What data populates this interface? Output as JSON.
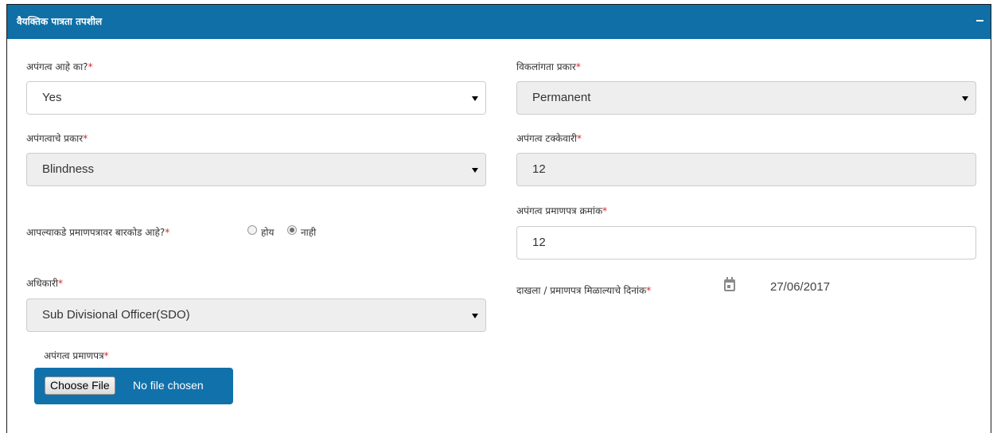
{
  "panel": {
    "title": "वैयक्तिक पात्रता तपशील",
    "collapse_symbol": "−"
  },
  "fields": {
    "disability": {
      "label": "अपंगत्व आहे का?",
      "required_mark": "*",
      "value": "Yes"
    },
    "handicap_type": {
      "label": "विकलांगता प्रकार",
      "required_mark": "*",
      "value": "Permanent"
    },
    "disability_type": {
      "label": "अपंगत्वाचे प्रकार",
      "required_mark": "*",
      "value": "Blindness"
    },
    "disability_percentage": {
      "label": "अपंगत्व टक्केवारी",
      "required_mark": "*",
      "value": "12"
    },
    "barcode_question": {
      "label": "आपल्याकडे प्रमाणपत्रावर बारकोड आहे?",
      "required_mark": "*",
      "options": [
        "होय",
        "नाही"
      ],
      "selected": "नाही"
    },
    "certificate_number": {
      "label": "अपंगत्व प्रमाणपत्र क्रमांक",
      "required_mark": "*",
      "value": "12"
    },
    "officer": {
      "label": "अधिकारी",
      "required_mark": "*",
      "value": "Sub Divisional Officer(SDO)"
    },
    "certificate_date": {
      "label": "दाखला / प्रमाणपत्र मिळाल्याचे दिनांक",
      "required_mark": "*",
      "value": "27/06/2017"
    },
    "certificate_file": {
      "label": "अपंगत्व प्रमाणपत्र",
      "required_mark": "*",
      "button_label": "Choose File",
      "status": "No file chosen"
    }
  },
  "icons": {
    "collapse": "minus-icon",
    "select_caret": "caret-down-icon",
    "calendar": "calendar-icon"
  },
  "colors": {
    "header": "#0f6fa6",
    "required": "#d9262a",
    "file_box": "#1171ab",
    "disabled_field": "#eeeeee"
  }
}
